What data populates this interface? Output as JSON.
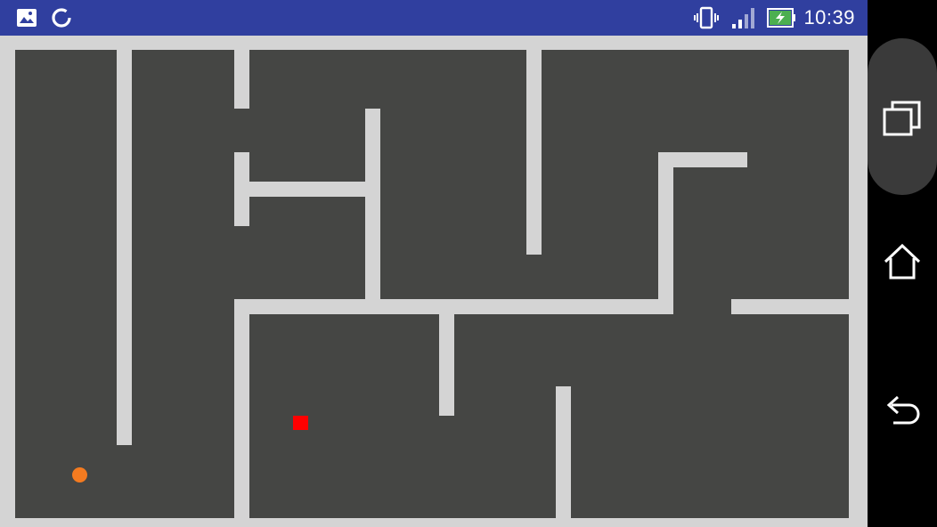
{
  "status_bar": {
    "time": "10:39",
    "left_icons": [
      "image-icon",
      "sync-icon"
    ],
    "right_icons": [
      "vibrate-icon",
      "signal-icon",
      "battery-charging-icon"
    ],
    "background_color": "#303F9F"
  },
  "game": {
    "wall_color": "#d4d4d4",
    "floor_color": "#454644",
    "ball": {
      "name": "ball",
      "color": "#F47B20"
    },
    "goal": {
      "name": "goal",
      "color": "#FF0000"
    }
  },
  "nav_bar": {
    "buttons": [
      "recents-icon",
      "home-icon",
      "back-icon"
    ]
  }
}
